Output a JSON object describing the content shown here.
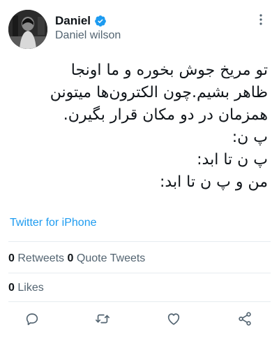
{
  "author": {
    "display_name": "Daniel",
    "handle": "Daniel wilson",
    "verified": true
  },
  "tweet": {
    "lines": [
      "تو مریخ جوش بخوره و ما اونجا",
      "ظاهر بشیم.چون الکترون‌ها میتونن",
      "همزمان در دو مکان قرار بگیرن.",
      "پ ن:",
      "پ ن تا ابد:",
      "من و پ ن تا ابد:"
    ],
    "source": "Twitter for iPhone"
  },
  "stats": {
    "retweets_count": "0",
    "retweets_label": "Retweets",
    "quote_count": "0",
    "quote_label": "Quote Tweets",
    "likes_count": "0",
    "likes_label": "Likes"
  },
  "icons": {
    "more": "more-vertical-icon",
    "reply": "reply-icon",
    "retweet": "retweet-icon",
    "like": "heart-icon",
    "share": "share-icon",
    "verified": "verified-badge-icon"
  },
  "colors": {
    "accent": "#1d9bf0",
    "text": "#0f1419",
    "secondary": "#536471",
    "divider": "#e6ecf0"
  }
}
